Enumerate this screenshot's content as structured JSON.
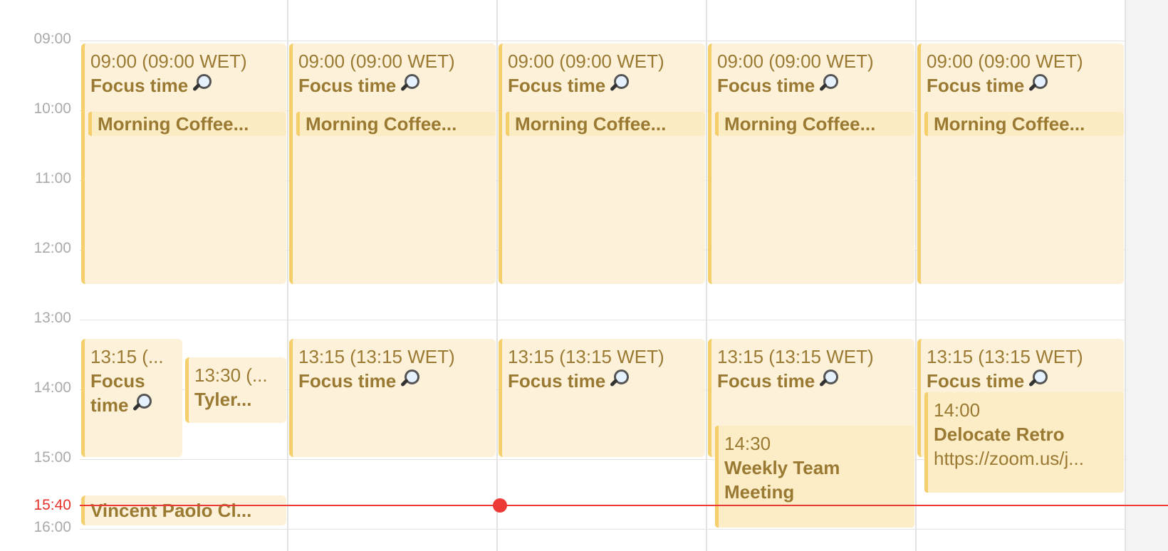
{
  "time_labels": [
    "09:00",
    "10:00",
    "11:00",
    "12:00",
    "13:00",
    "14:00",
    "15:00",
    "16:00"
  ],
  "now_label": "15:40",
  "days": [
    {
      "morning": {
        "time": "09:00 (09:00 WET)",
        "title": "Focus time",
        "coffee": "Morning Coffee..."
      },
      "afternoon": {
        "time": "13:15 (...",
        "title": "Focus time"
      },
      "tyler": {
        "time": "13:30 (...",
        "title": "Tyler..."
      },
      "vincent": {
        "title": "Vincent Paolo Cl..."
      }
    },
    {
      "morning": {
        "time": "09:00 (09:00 WET)",
        "title": "Focus time",
        "coffee": "Morning Coffee..."
      },
      "afternoon": {
        "time": "13:15 (13:15 WET)",
        "title": "Focus time"
      }
    },
    {
      "morning": {
        "time": "09:00 (09:00 WET)",
        "title": "Focus time",
        "coffee": "Morning Coffee..."
      },
      "afternoon": {
        "time": "13:15 (13:15 WET)",
        "title": "Focus time"
      }
    },
    {
      "morning": {
        "time": "09:00 (09:00 WET)",
        "title": "Focus time",
        "coffee": "Morning Coffee..."
      },
      "afternoon": {
        "time": "13:15 (13:15 WET)",
        "title": "Focus time"
      },
      "weekly": {
        "time": "14:30",
        "title": "Weekly Team Meeting"
      }
    },
    {
      "morning": {
        "time": "09:00 (09:00 WET)",
        "title": "Focus time",
        "coffee": "Morning Coffee..."
      },
      "afternoon": {
        "time": "13:15 (13:15 WET)",
        "title": "Focus time"
      },
      "retro": {
        "time": "14:00",
        "title": "Delocate Retro",
        "link": "https://zoom.us/j..."
      }
    }
  ],
  "colors": {
    "event_bg": "#fdf2d9",
    "event_border": "#f5cf6c",
    "event_text": "#9a7a33",
    "now_indicator": "#ee3a36"
  },
  "icons": {
    "focus": "magnifying-glass-icon"
  }
}
